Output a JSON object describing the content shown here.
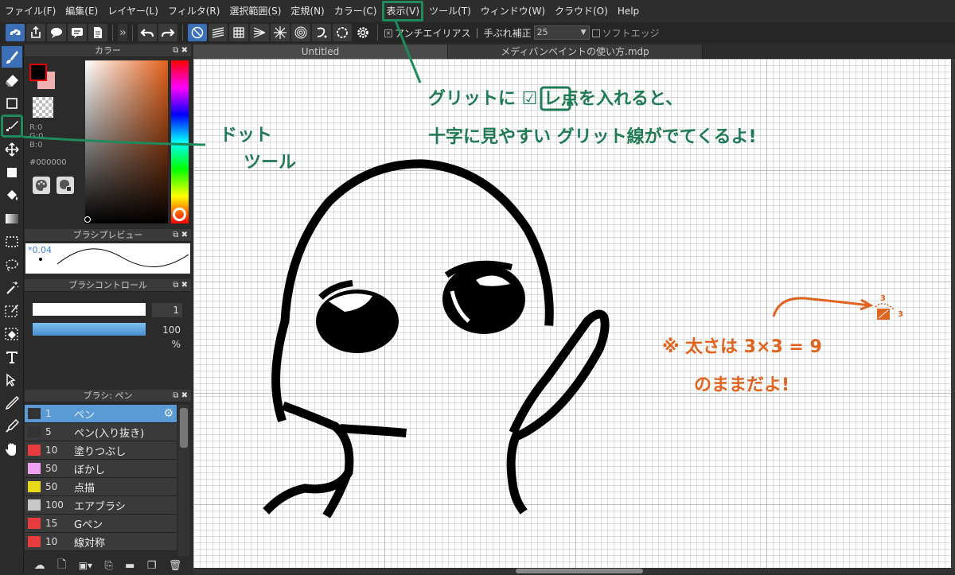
{
  "menu": [
    "ファイル(F)",
    "編集(E)",
    "レイヤー(L)",
    "フィルタ(R)",
    "選択範囲(S)",
    "定規(N)",
    "カラー(C)",
    "表示(V)",
    "ツール(T)",
    "ウィンドウ(W)",
    "クラウド(O)",
    "Help"
  ],
  "toolbar": {
    "antialias_label": "アンチエイリアス",
    "stabilizer_label": "手ぶれ補正",
    "stabilizer_value": "25",
    "soft_edge_label": "ソフトエッジ"
  },
  "tabs": [
    "Untitled",
    "メディバンペイントの使い方.mdp"
  ],
  "color_panel": {
    "title": "カラー",
    "r": "R:0",
    "g": "G:0",
    "b": "B:0",
    "hex": "#000000"
  },
  "brush_preview": {
    "title": "ブラシプレビュー",
    "size": "0.04"
  },
  "brush_control": {
    "title": "ブラシコントロール",
    "size_value": "1",
    "opacity_value": "100 %"
  },
  "brush_list": {
    "title": "ブラシ: ペン",
    "items": [
      {
        "size": "1",
        "name": "ペン",
        "color": "#333333"
      },
      {
        "size": "5",
        "name": "ペン(入り抜き)",
        "color": "#333333"
      },
      {
        "size": "10",
        "name": "塗りつぶし",
        "color": "#e83b3b"
      },
      {
        "size": "50",
        "name": "ぼかし",
        "color": "#f0a0f0"
      },
      {
        "size": "50",
        "name": "点描",
        "color": "#e8d81a"
      },
      {
        "size": "100",
        "name": "エアブラシ",
        "color": "#c8c8c8"
      },
      {
        "size": "15",
        "name": "Gペン",
        "color": "#e83b3b"
      },
      {
        "size": "10",
        "name": "線対称",
        "color": "#e83b3b"
      }
    ]
  },
  "annotations": {
    "grid_line1": "グリットに ☑ レ点を入れると、",
    "grid_line2": "十字に見やすい グリット線がでてくるよ!",
    "dot_tool1": "ドット",
    "dot_tool2": "ツール",
    "thickness1": "※ 太さは 3×3 = 9",
    "thickness2": "のままだよ!",
    "dim_top": "3",
    "dim_right": "3"
  },
  "colors": {
    "annotation_green": "#1f7a55",
    "annotation_orange": "#e0641e",
    "highlight": "#1f8a5b"
  }
}
